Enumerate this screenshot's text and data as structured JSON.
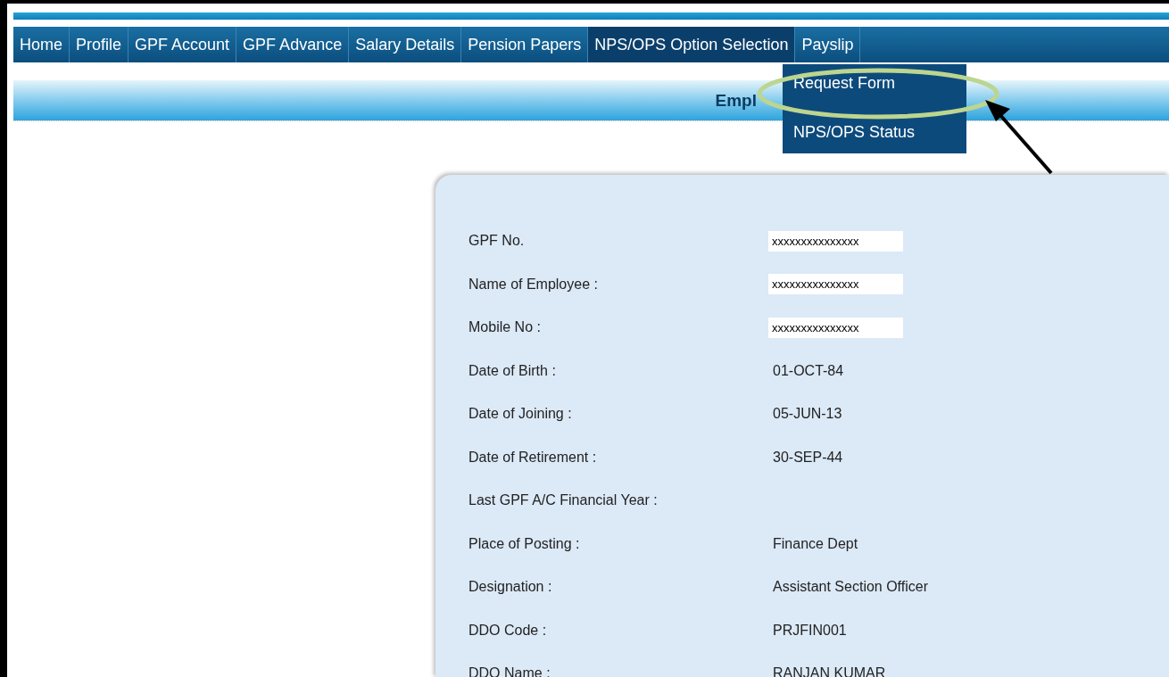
{
  "nav": {
    "items": [
      {
        "label": "Home",
        "selected": false
      },
      {
        "label": "Profile",
        "selected": false
      },
      {
        "label": "GPF Account",
        "selected": false
      },
      {
        "label": "GPF Advance",
        "selected": false
      },
      {
        "label": "Salary Details",
        "selected": false
      },
      {
        "label": "Pension Papers",
        "selected": false
      },
      {
        "label": "NPS/OPS Option Selection",
        "selected": true
      },
      {
        "label": "Payslip",
        "selected": false
      }
    ]
  },
  "dropdown": {
    "items": [
      {
        "label": "Request Form",
        "circled": true
      },
      {
        "label": "NPS/OPS Status",
        "circled": false
      }
    ]
  },
  "header": {
    "title": "Empl"
  },
  "form": {
    "rows": [
      {
        "label": "GPF No.",
        "value": "xxxxxxxxxxxxxxx",
        "kind": "input"
      },
      {
        "label": "Name of Employee :",
        "value": "xxxxxxxxxxxxxxx",
        "kind": "input"
      },
      {
        "label": "Mobile No :",
        "value": "xxxxxxxxxxxxxxx",
        "kind": "input"
      },
      {
        "label": "Date of Birth :",
        "value": "01-OCT-84",
        "kind": "text"
      },
      {
        "label": "Date of Joining :",
        "value": "05-JUN-13",
        "kind": "text"
      },
      {
        "label": "Date of Retirement :",
        "value": "30-SEP-44",
        "kind": "text"
      },
      {
        "label": "Last GPF A/C Financial Year :",
        "kind": "text"
      },
      {
        "label": "Place of Posting :",
        "value": "Finance Dept",
        "kind": "text"
      },
      {
        "label": "Designation :",
        "value": "Assistant Section Officer",
        "kind": "text"
      },
      {
        "label": "DDO Code :",
        "value": "PRJFIN001",
        "kind": "text"
      },
      {
        "label": "DDO Name :",
        "value": "RANJAN KUMAR",
        "kind": "text"
      }
    ]
  }
}
